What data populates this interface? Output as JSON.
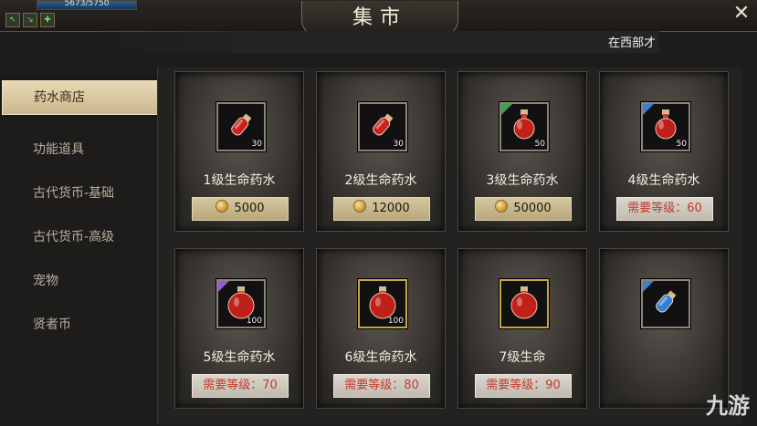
{
  "hud": {
    "hp_text": "5673/5750",
    "icons": [
      "↖",
      "↘",
      "✚"
    ]
  },
  "window": {
    "title": "集市",
    "close_glyph": "✕",
    "notice": "在西部才"
  },
  "sidebar": {
    "items": [
      {
        "label": "药水商店",
        "active": true
      },
      {
        "label": "功能道具",
        "active": false
      },
      {
        "label": "古代货币-基础",
        "active": false
      },
      {
        "label": "古代货币-高级",
        "active": false
      },
      {
        "label": "宠物",
        "active": false
      },
      {
        "label": "贤者币",
        "active": false
      }
    ]
  },
  "items": [
    {
      "name": "1级生命药水",
      "qty": "30",
      "price": "5000",
      "requirement": null,
      "frame": "plain",
      "corner_color": null,
      "potion": "vial-red"
    },
    {
      "name": "2级生命药水",
      "qty": "30",
      "price": "12000",
      "requirement": null,
      "frame": "plain",
      "corner_color": null,
      "potion": "vial-red"
    },
    {
      "name": "3级生命药水",
      "qty": "50",
      "price": "50000",
      "requirement": null,
      "frame": "plain",
      "corner_color": "#3aa44a",
      "potion": "flask-red"
    },
    {
      "name": "4级生命药水",
      "qty": "50",
      "price": null,
      "requirement": "需要等级：60",
      "frame": "plain",
      "corner_color": "#3f7fd1",
      "potion": "flask-red"
    },
    {
      "name": "5级生命药水",
      "qty": "100",
      "price": null,
      "requirement": "需要等级：70",
      "frame": "plain",
      "corner_color": "#9b56d6",
      "potion": "flask-big-red"
    },
    {
      "name": "6级生命药水",
      "qty": "100",
      "price": null,
      "requirement": "需要等级：80",
      "frame": "gold",
      "corner_color": null,
      "potion": "flask-big-red"
    },
    {
      "name": "7级生命",
      "qty": "",
      "price": null,
      "requirement": "需要等级：90",
      "frame": "gold",
      "corner_color": null,
      "potion": "flask-big-red"
    },
    {
      "name": "",
      "qty": "",
      "price": null,
      "requirement": "",
      "frame": "plain",
      "corner_color": "#3f7fd1",
      "potion": "vial-blue"
    }
  ],
  "watermark": {
    "text": "九游"
  },
  "colors": {
    "panel_bg": "#1d1c1a",
    "price_bar": "#d6c79f",
    "requirement_text": "#c33a2e",
    "active_tab": "#e9d9b4"
  }
}
